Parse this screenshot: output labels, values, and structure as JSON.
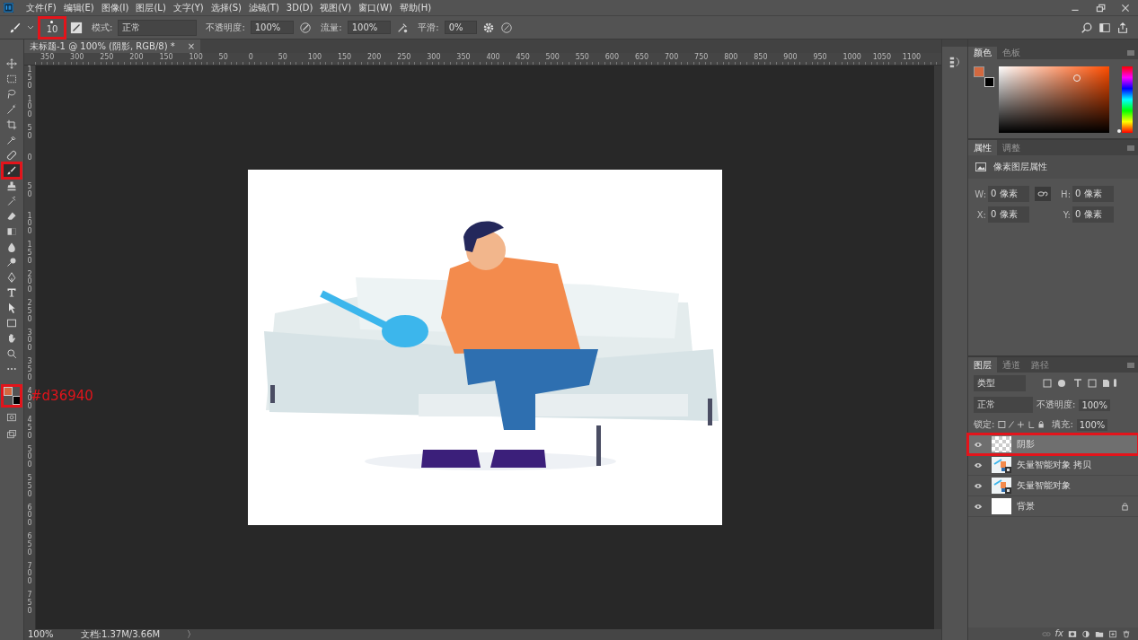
{
  "menu": [
    "文件(F)",
    "编辑(E)",
    "图像(I)",
    "图层(L)",
    "文字(Y)",
    "选择(S)",
    "滤镜(T)",
    "3D(D)",
    "视图(V)",
    "窗口(W)",
    "帮助(H)"
  ],
  "options": {
    "brush_size": "10",
    "brush_preset_highlighted": true,
    "mode_label": "模式:",
    "mode": "正常",
    "opacity_label": "不透明度:",
    "opacity": "100%",
    "flow_label": "流量:",
    "flow": "100%",
    "smoothing_label": "平滑:",
    "smoothing": "0%"
  },
  "document_tab": {
    "title": "未标题-1 @ 100% (阴影, RGB/8) *",
    "close": "×"
  },
  "ruler_h": [
    "350",
    "300",
    "250",
    "200",
    "150",
    "100",
    "50",
    "0",
    "50",
    "100",
    "150",
    "200",
    "250",
    "300",
    "350",
    "400",
    "450",
    "500",
    "550",
    "600",
    "650",
    "700",
    "750",
    "800",
    "850",
    "900",
    "950",
    "1000",
    "1050",
    "1100"
  ],
  "ruler_v": [
    "150",
    "100",
    "50",
    "0",
    "50",
    "100",
    "150",
    "200",
    "250",
    "300",
    "350",
    "400",
    "450",
    "500",
    "550",
    "600",
    "650",
    "700",
    "750"
  ],
  "tools": [
    {
      "kind": "move",
      "selected": false,
      "highlighted": false
    },
    {
      "kind": "marquee",
      "selected": false,
      "highlighted": false
    },
    {
      "kind": "lasso",
      "selected": false,
      "highlighted": false
    },
    {
      "kind": "wand",
      "selected": false,
      "highlighted": false
    },
    {
      "kind": "crop",
      "selected": false,
      "highlighted": false
    },
    {
      "kind": "eyedropper",
      "selected": false,
      "highlighted": false
    },
    {
      "kind": "bandage",
      "selected": false,
      "highlighted": false
    },
    {
      "kind": "brush",
      "selected": true,
      "highlighted": true
    },
    {
      "kind": "stamp",
      "selected": false,
      "highlighted": false
    },
    {
      "kind": "history",
      "selected": false,
      "highlighted": false
    },
    {
      "kind": "eraser",
      "selected": false,
      "highlighted": false
    },
    {
      "kind": "gradient",
      "selected": false,
      "highlighted": false
    },
    {
      "kind": "drop",
      "selected": false,
      "highlighted": false
    },
    {
      "kind": "dodge",
      "selected": false,
      "highlighted": false
    },
    {
      "kind": "pen",
      "selected": false,
      "highlighted": false
    },
    {
      "kind": "type",
      "selected": false,
      "highlighted": false
    },
    {
      "kind": "pointer",
      "selected": false,
      "highlighted": false
    },
    {
      "kind": "rectangle",
      "selected": false,
      "highlighted": false
    },
    {
      "kind": "hand",
      "selected": false,
      "highlighted": false
    },
    {
      "kind": "zoom",
      "selected": false,
      "highlighted": false
    },
    {
      "kind": "more",
      "selected": false,
      "highlighted": false
    }
  ],
  "swatches": {
    "highlighted": true,
    "items": [
      {
        "kind": "foreground",
        "color": "#d36940"
      },
      {
        "kind": "background",
        "color": "#000000"
      }
    ]
  },
  "annotation": "#d36940",
  "color_panel": {
    "tabs": [
      {
        "label": "颜色",
        "selected": true
      },
      {
        "label": "色板",
        "selected": false
      }
    ]
  },
  "properties_panel": {
    "tabs": [
      {
        "label": "属性",
        "selected": true
      },
      {
        "label": "调整",
        "selected": false
      }
    ],
    "header": "像素图层属性",
    "fields": [
      {
        "label": "W:",
        "value": "0 像素"
      },
      {
        "label": "H:",
        "value": "0 像素"
      },
      {
        "label": "X:",
        "value": "0 像素"
      },
      {
        "label": "Y:",
        "value": "0 像素"
      }
    ]
  },
  "layers_panel": {
    "tabs": [
      {
        "label": "图层",
        "selected": true
      },
      {
        "label": "通道",
        "selected": false
      },
      {
        "label": "路径",
        "selected": false
      }
    ],
    "filter": "类型",
    "blend": "正常",
    "opacity_label": "不透明度:",
    "opacity": "100%",
    "lock_label": "锁定:",
    "fill_label": "填充:",
    "fill": "100%",
    "layers": [
      {
        "name": "阴影",
        "kind": "transparent",
        "visible": true,
        "selected": true,
        "locked": false,
        "highlighted": true
      },
      {
        "name": "矢量智能对象 拷贝",
        "kind": "smart",
        "visible": true,
        "selected": false,
        "locked": false,
        "highlighted": false
      },
      {
        "name": "矢量智能对象",
        "kind": "smart",
        "visible": true,
        "selected": false,
        "locked": false,
        "highlighted": false
      },
      {
        "name": "背景",
        "kind": "white",
        "visible": true,
        "selected": false,
        "locked": true,
        "highlighted": false
      }
    ],
    "footer_fx": "fx"
  },
  "status": {
    "zoom": "100%",
    "doc": "文档:1.37M/3.66M",
    "arrow": "〉"
  }
}
